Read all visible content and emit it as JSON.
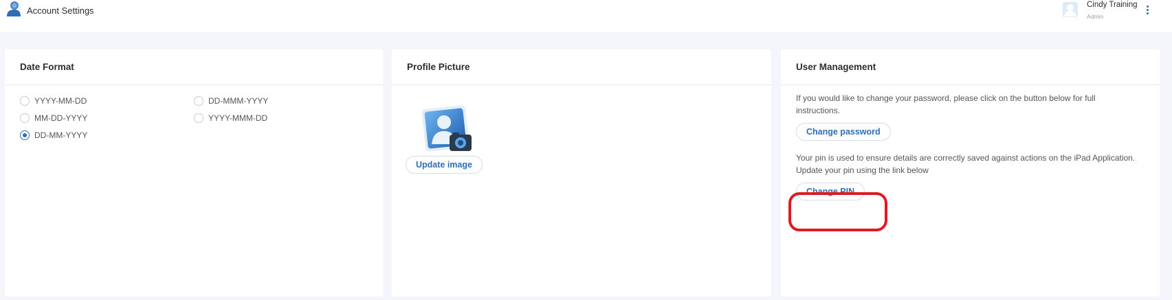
{
  "header": {
    "title": "Account Settings",
    "user_name": "Cindy Training",
    "user_role": "Admin"
  },
  "date_format": {
    "title": "Date Format",
    "options": [
      "YYYY-MM-DD",
      "MM-DD-YYYY",
      "DD-MM-YYYY",
      "DD-MMM-YYYY",
      "YYYY-MMM-DD"
    ],
    "selected": "DD-MM-YYYY"
  },
  "profile_picture": {
    "title": "Profile Picture",
    "update_label": "Update image"
  },
  "user_management": {
    "title": "User Management",
    "password_text": "If you would like to change your password, please click on the button below for full instructions.",
    "change_password_label": "Change password",
    "pin_text": "Your pin is used to ensure details are correctly saved against actions on the iPad Application. Update your pin using the link below",
    "change_pin_label": "Change PIN"
  },
  "colors": {
    "accent": "#2f6db5",
    "highlight": "#e01a22",
    "background": "#f4f6fb"
  }
}
